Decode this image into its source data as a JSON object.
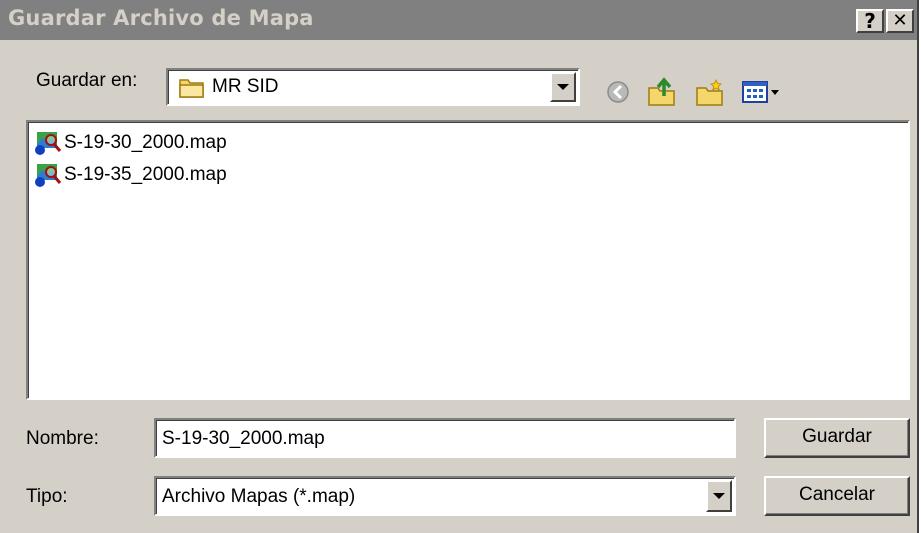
{
  "window": {
    "title": "Guardar Archivo de Mapa",
    "help_label": "?",
    "close_label": "✕"
  },
  "location": {
    "label": "Guardar en:",
    "value": "MR SID",
    "folder_icon": "folder-icon"
  },
  "toolbar": {
    "icons": [
      "back-icon",
      "up-folder-icon",
      "new-folder-icon",
      "view-menu-icon"
    ]
  },
  "files": [
    {
      "name": "S-19-30_2000.map",
      "icon": "map-file-icon"
    },
    {
      "name": "S-19-35_2000.map",
      "icon": "map-file-icon"
    }
  ],
  "filename": {
    "label": "Nombre:",
    "value": "S-19-30_2000.map"
  },
  "filetype": {
    "label": "Tipo:",
    "value": "Archivo Mapas (*.map)"
  },
  "buttons": {
    "save": "Guardar",
    "cancel": "Cancelar"
  },
  "colors": {
    "dialog_bg": "#d4d0c8",
    "titlebar_inactive": "#808080",
    "folder_yellow": "#f5d66a"
  }
}
